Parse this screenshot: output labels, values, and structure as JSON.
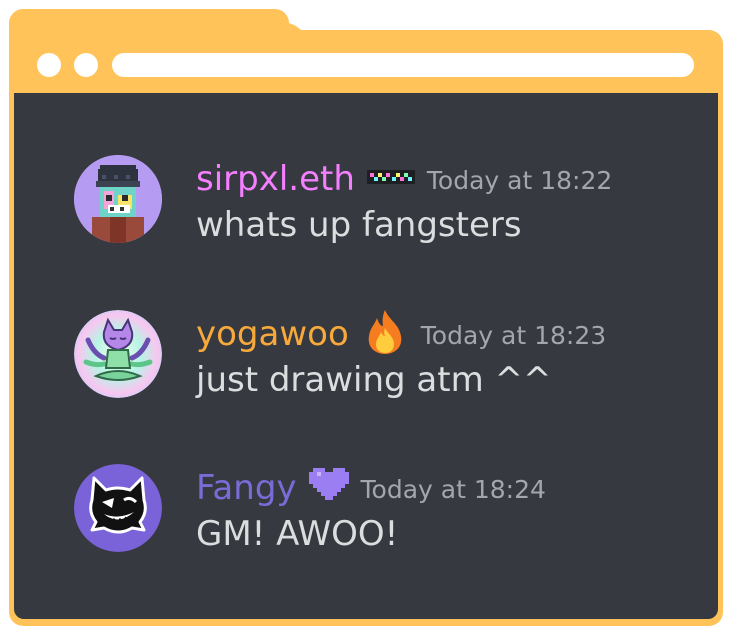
{
  "colors": {
    "frame": "#ffc35a",
    "panel": "#36393f",
    "message_text": "#dcddde",
    "timestamp": "#a3a6aa"
  },
  "messages": [
    {
      "username": "sirpxl.eth",
      "username_color": "#f47fff",
      "badge_icon": "pixel-glasses-icon",
      "timestamp": "Today at 18:22",
      "text": "whats up fangsters",
      "avatar_icon": "pixel-beanie-character-avatar"
    },
    {
      "username": "yogawoo",
      "username_color": "#f8a93c",
      "badge_icon": "fire-icon",
      "timestamp": "Today at 18:23",
      "text": "just drawing atm ^^",
      "avatar_icon": "meditating-creature-avatar"
    },
    {
      "username": "Fangy",
      "username_color": "#7b6bd6",
      "badge_icon": "pixel-heart-icon",
      "timestamp": "Today at 18:24",
      "text": "GM! AWOO!",
      "avatar_icon": "black-wolf-avatar"
    }
  ]
}
